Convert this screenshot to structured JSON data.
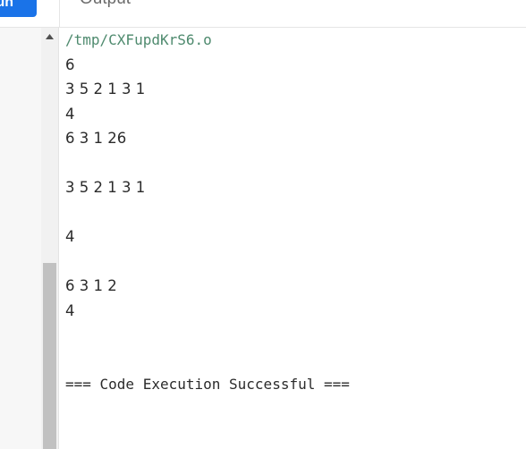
{
  "header": {
    "run_label": "un",
    "output_tab_label": "Output"
  },
  "output": {
    "path": "/tmp/CXFupdKrS6.o",
    "lines": [
      "6",
      "3 5 2 1 3 1",
      "4",
      "6 3 1 26",
      "",
      "3 5 2 1 3 1",
      "",
      "4",
      "",
      "6 3 1 2",
      "4",
      "",
      "",
      ""
    ],
    "success_message": "=== Code Execution Successful ==="
  },
  "icons": {
    "scroll_up": "triangle-up-icon"
  }
}
